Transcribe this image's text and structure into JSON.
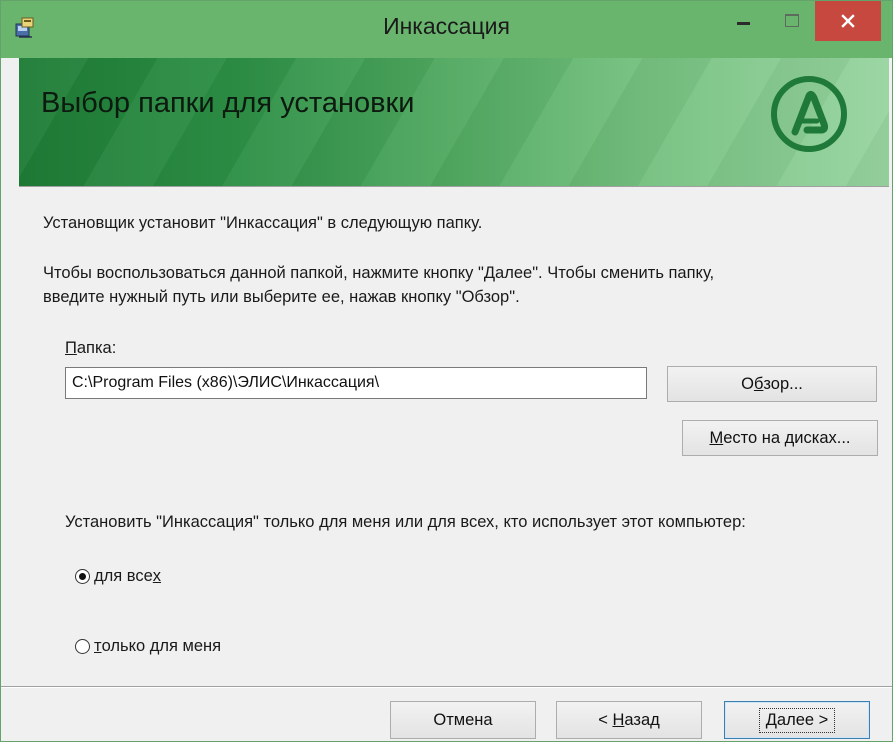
{
  "window": {
    "title": "Инкассация",
    "icons": {
      "app": "installer-icon",
      "minimize": "minimize-icon",
      "maximize": "maximize-icon",
      "close": "close-icon"
    }
  },
  "banner": {
    "title": "Выбор папки для установки",
    "logo": "company-logo-icon"
  },
  "body": {
    "intro": "Установщик установит \"Инкассация\" в следующую папку.",
    "hint_line1": "Чтобы воспользоваться данной папкой, нажмите кнопку \"Далее\". Чтобы сменить папку,",
    "hint_line2": "введите нужный путь или выберите ее, нажав кнопку \"Обзор\"."
  },
  "folder": {
    "label_underlined": "П",
    "label_rest": "апка:",
    "value": "C:\\Program Files (x86)\\ЭЛИС\\Инкассация\\"
  },
  "buttons": {
    "browse_pre": "О",
    "browse_ul": "б",
    "browse_post": "зор...",
    "disk_ul": "М",
    "disk_post": "есто на дисках...",
    "cancel": "Отмена",
    "back_pre": "< ",
    "back_ul": "Н",
    "back_post": "азад",
    "next_ul": "Д",
    "next_post": "алее >"
  },
  "install_for": {
    "question": "Установить \"Инкассация\" только для меня или для всех, кто использует этот компьютер:",
    "options": [
      {
        "pre": "для все",
        "ul": "х",
        "post": "",
        "selected": true
      },
      {
        "pre": "",
        "ul": "т",
        "post": "олько для меня",
        "selected": false
      }
    ]
  },
  "colors": {
    "titlebar": "#6ab56e",
    "close_button": "#c7483e",
    "banner_dark": "#1e7c36",
    "banner_light": "#98d4a0",
    "logo": "#1f7a3a"
  }
}
